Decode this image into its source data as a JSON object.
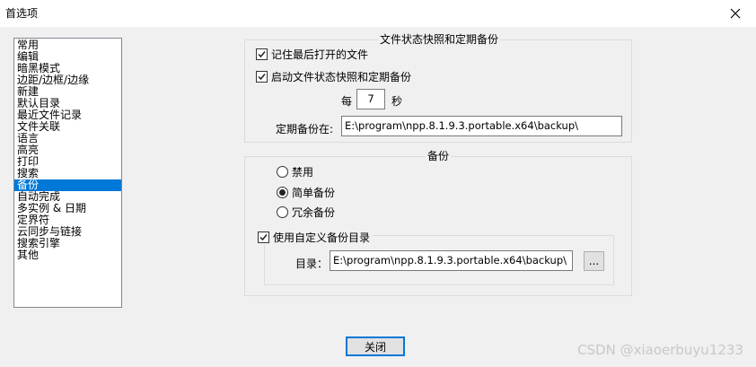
{
  "window": {
    "title": "首选项",
    "close_icon": "close-icon"
  },
  "sidebar": {
    "items": [
      "常用",
      "编辑",
      "暗黑模式",
      "边距/边框/边缘",
      "新建",
      "默认目录",
      "最近文件记录",
      "文件关联",
      "语言",
      "高亮",
      "打印",
      "搜索",
      "备份",
      "自动完成",
      "多实例 & 日期",
      "定界符",
      "云同步与链接",
      "搜索引擎",
      "其他"
    ],
    "selected_index": 12
  },
  "snapshot_group": {
    "title": "文件状态快照和定期备份",
    "remember_last_session": {
      "label": "记住最后打开的文件",
      "checked": true
    },
    "enable_snapshot": {
      "label": "启动文件状态快照和定期备份",
      "checked": true
    },
    "interval_prefix": "每",
    "interval_value": "7",
    "interval_suffix": "秒",
    "backup_path_label": "定期备份在:",
    "backup_path_value": "E:\\program\\npp.8.1.9.3.portable.x64\\backup\\"
  },
  "backup_group": {
    "title": "备份",
    "options": [
      {
        "label": "禁用",
        "checked": false
      },
      {
        "label": "简单备份",
        "checked": true
      },
      {
        "label": "冗余备份",
        "checked": false
      }
    ],
    "custom_dir": {
      "label": "使用自定义备份目录",
      "checked": true,
      "dir_label": "目录：",
      "dir_value": "E:\\program\\npp.8.1.9.3.portable.x64\\backup\\",
      "browse_label": "..."
    }
  },
  "footer": {
    "close_label": "关闭"
  },
  "watermark": "CSDN @xiaoerbuyu1233"
}
